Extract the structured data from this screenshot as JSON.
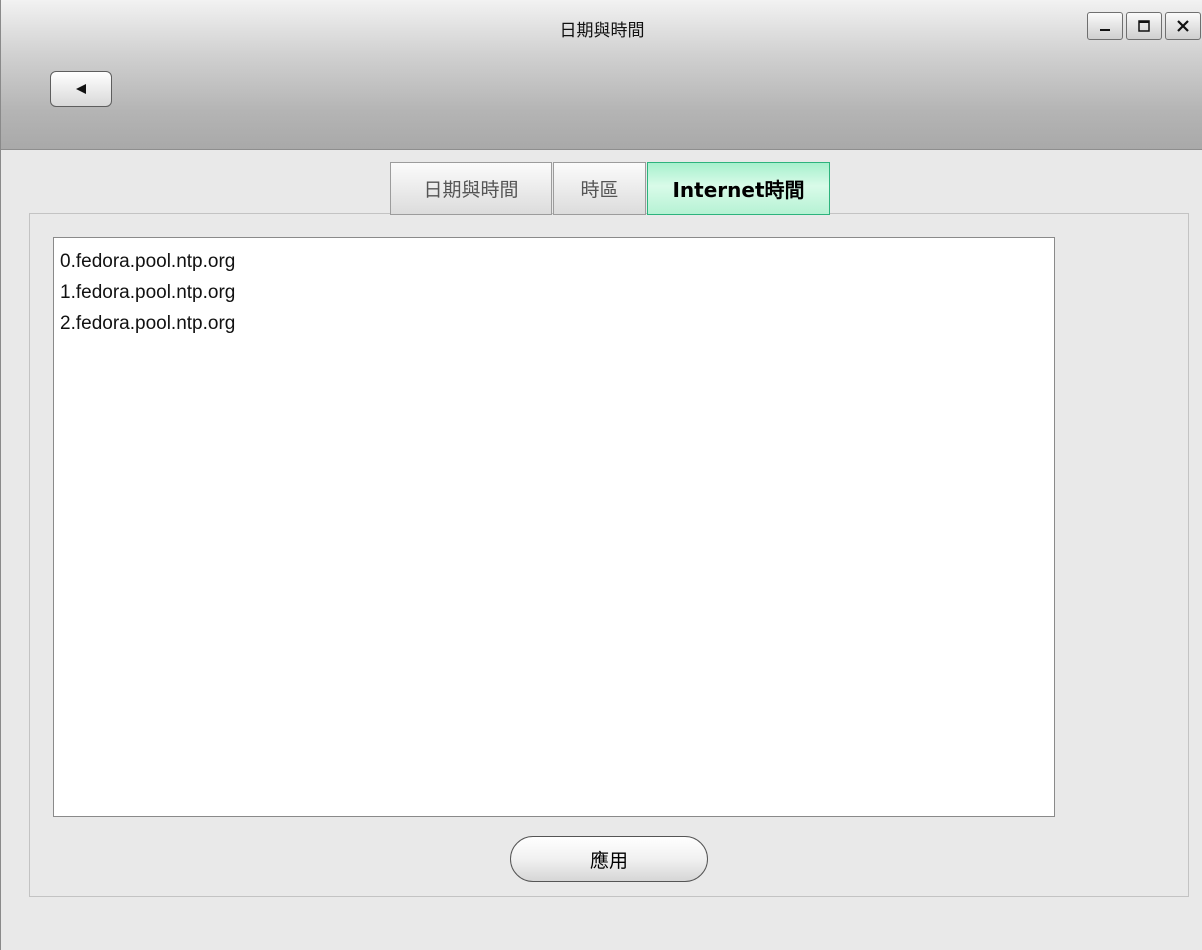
{
  "window": {
    "title": "日期與時間",
    "controls": [
      {
        "name": "minimize",
        "icon": "minimize-icon"
      },
      {
        "name": "maximize",
        "icon": "maximize-icon"
      },
      {
        "name": "close",
        "icon": "close-icon"
      }
    ]
  },
  "toolbar": {
    "back_icon": "back-arrow-icon"
  },
  "tabs": [
    {
      "label": "日期與時間",
      "selected": false
    },
    {
      "label": "時區",
      "selected": false
    },
    {
      "label": "Internet時間",
      "selected": true
    }
  ],
  "ntp_servers": [
    "0.fedora.pool.ntp.org",
    "1.fedora.pool.ntp.org",
    "2.fedora.pool.ntp.org"
  ],
  "actions": {
    "apply_label": "應用"
  },
  "colors": {
    "active_tab": "#b6f2d4",
    "active_tab_border": "#2db37d",
    "titlebar": "#b4b4b4",
    "background": "#e9e9e9"
  }
}
